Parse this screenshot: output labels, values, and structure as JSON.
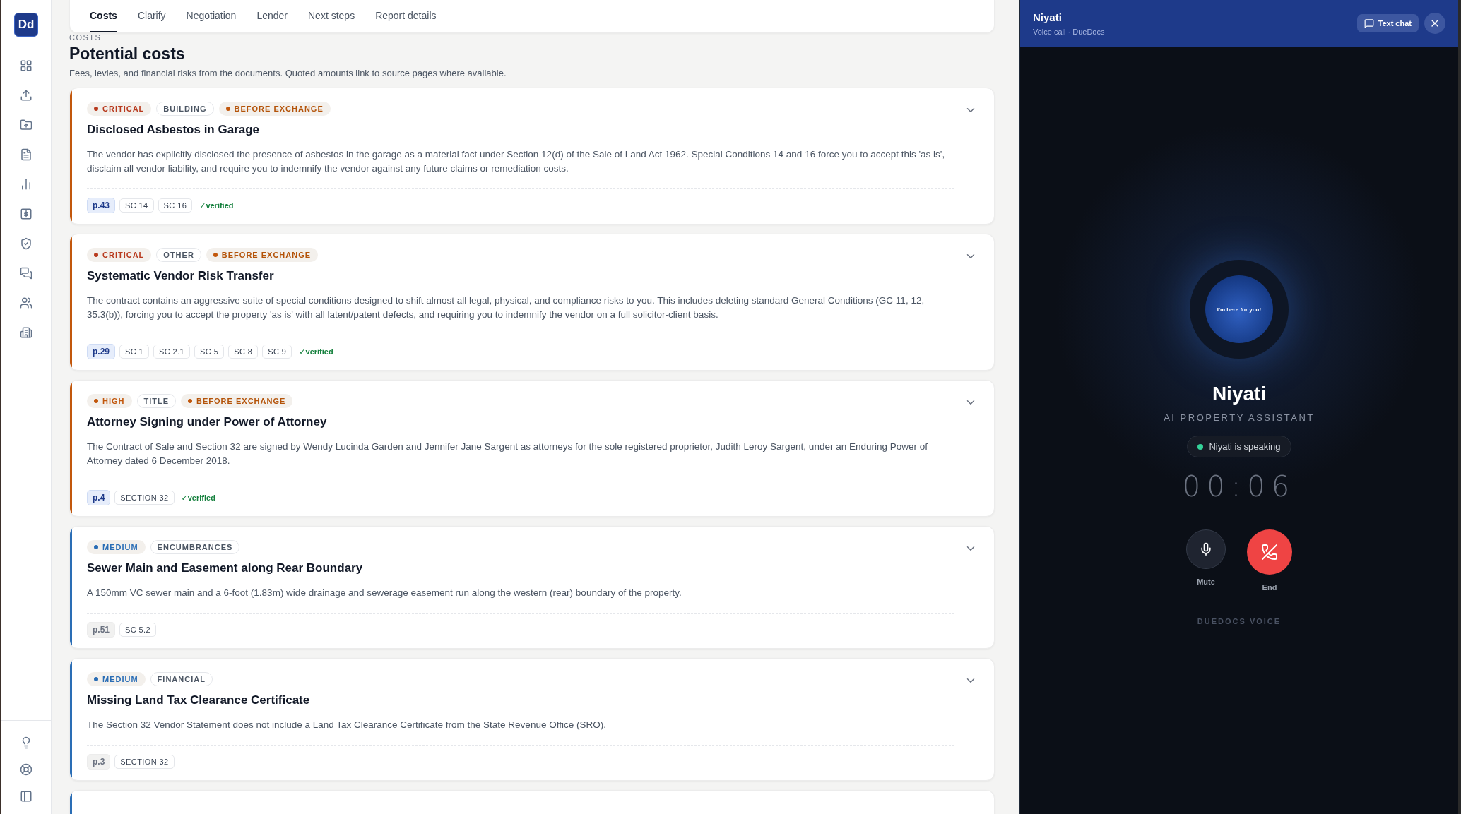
{
  "sidebar": {
    "logo": "Dd"
  },
  "tabs": [
    {
      "label": "Costs",
      "selected": true
    },
    {
      "label": "Clarify",
      "selected": false
    },
    {
      "label": "Negotiation",
      "selected": false
    },
    {
      "label": "Lender",
      "selected": false
    },
    {
      "label": "Next steps",
      "selected": false
    },
    {
      "label": "Report details",
      "selected": false
    }
  ],
  "section": {
    "eyebrow": "COSTS",
    "title": "Potential costs",
    "description": "Fees, levies, and financial risks from the documents. Quoted amounts link to source pages where available."
  },
  "cards": [
    {
      "color": "#c2570c",
      "severity": {
        "label": "CRITICAL",
        "color": "#b83a1e"
      },
      "category": "BUILDING",
      "timing": "BEFORE EXCHANGE",
      "title": "Disclosed Asbestos in Garage",
      "body": "The vendor has explicitly disclosed the presence of asbestos in the garage as a material fact under Section 12(d) of the Sale of Land Act 1962. Special Conditions 14 and 16 force you to accept this 'as is', disclaim all vendor liability, and require you to indemnify the vendor against any future claims or remediation costs.",
      "page": {
        "label": "p.43",
        "highlighted": true
      },
      "refs": [
        "SC 14",
        "SC 16"
      ],
      "verified": "✓verified"
    },
    {
      "color": "#c2570c",
      "severity": {
        "label": "CRITICAL",
        "color": "#b83a1e"
      },
      "category": "OTHER",
      "timing": "BEFORE EXCHANGE",
      "title": "Systematic Vendor Risk Transfer",
      "body": "The contract contains an aggressive suite of special conditions designed to shift almost all legal, physical, and compliance risks to you. This includes deleting standard General Conditions (GC 11, 12, 35.3(b)), forcing you to accept the property 'as is' with all latent/patent defects, and requiring you to indemnify the vendor on a full solicitor-client basis.",
      "page": {
        "label": "p.29",
        "highlighted": true
      },
      "refs": [
        "SC 1",
        "SC 2.1",
        "SC 5",
        "SC 8",
        "SC 9"
      ],
      "verified": "✓verified"
    },
    {
      "color": "#c2570c",
      "severity": {
        "label": "HIGH",
        "color": "#c2570c"
      },
      "category": "TITLE",
      "timing": "BEFORE EXCHANGE",
      "title": "Attorney Signing under Power of Attorney",
      "body": "The Contract of Sale and Section 32 are signed by Wendy Lucinda Garden and Jennifer Jane Sargent as attorneys for the sole registered proprietor, Judith Leroy Sargent, under an Enduring Power of Attorney dated 6 December 2018.",
      "page": {
        "label": "p.4",
        "highlighted": true
      },
      "refs": [
        "SECTION 32"
      ],
      "verified": "✓verified"
    },
    {
      "color": "#2a6db5",
      "severity": {
        "label": "MEDIUM",
        "color": "#2a6db5"
      },
      "category": "ENCUMBRANCES",
      "title": "Sewer Main and Easement along Rear Boundary",
      "body": "A 150mm VC sewer main and a 6-foot (1.83m) wide drainage and sewerage easement run along the western (rear) boundary of the property.",
      "page": {
        "label": "p.51",
        "highlighted": false
      },
      "refs": [
        "SC 5.2"
      ]
    },
    {
      "color": "#2a6db5",
      "severity": {
        "label": "MEDIUM",
        "color": "#2a6db5"
      },
      "category": "FINANCIAL",
      "title": "Missing Land Tax Clearance Certificate",
      "body": "The Section 32 Vendor Statement does not include a Land Tax Clearance Certificate from the State Revenue Office (SRO).",
      "page": {
        "label": "p.3",
        "highlighted": false
      },
      "refs": [
        "SECTION 32"
      ]
    },
    {
      "color": "#2a6db5"
    }
  ],
  "voice": {
    "title": "Niyati",
    "subtitle": "Voice call · DueDocs",
    "text_chat": "Text chat",
    "orb_text": "I'm here for you!",
    "name": "Niyati",
    "role": "AI PROPERTY ASSISTANT",
    "status": "Niyati is speaking",
    "speaking": true,
    "timer": "00:06",
    "mute": {
      "label": "Mute",
      "on": false
    },
    "end": "End",
    "footer": "DUEDOCS VOICE"
  }
}
